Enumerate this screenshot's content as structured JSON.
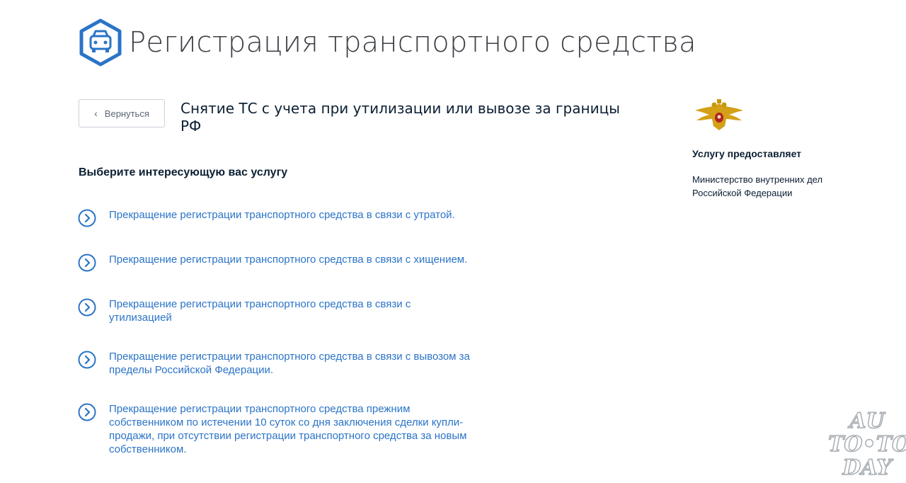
{
  "header": {
    "logo_icon": "car-hexagon-icon",
    "title": "Регистрация транспортного средства"
  },
  "back_button": {
    "label": "Вернуться",
    "icon": "chevron-left-icon"
  },
  "service": {
    "title": "Снятие ТС с учета при утилизации или вывозе за границы РФ"
  },
  "choose": {
    "heading": "Выберите интересующую вас услугу"
  },
  "options": [
    {
      "label": "Прекращение регистрации транспортного средства в связи с утратой."
    },
    {
      "label": "Прекращение регистрации транспортного средства в связи с хищением."
    },
    {
      "label": "Прекращение регистрации транспортного средства в связи с утилизацией"
    },
    {
      "label": "Прекращение регистрации транспортного средства в связи с вывозом за пределы Российской Федерации."
    },
    {
      "label": "Прекращение регистрации транспортного средства прежним собственником по истечении 10 суток со дня заключения сделки купли-продажи, при отсутствии регистрации транспортного средства за новым собственником."
    }
  ],
  "sidebar": {
    "emblem_icon": "mvd-emblem-icon",
    "provider_heading": "Услугу предоставляет",
    "provider_name": "Министерство внутренних дел Российской Федерации"
  },
  "watermark": {
    "line1": "AU",
    "line2": "TO•TO",
    "line3": "DAY"
  },
  "colors": {
    "accent": "#2b74c7",
    "text": "#0b1f33",
    "logo": "#2b74c7",
    "emblem": "#d4a017"
  }
}
